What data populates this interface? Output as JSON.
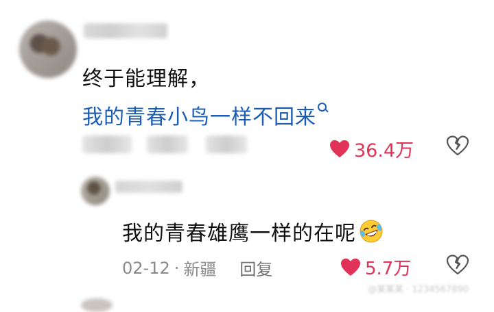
{
  "main_comment": {
    "line1": "终于能理解，",
    "line2": "我的青春小鸟一样不回来",
    "likes": "36.4万"
  },
  "reply": {
    "text": "我的青春雄鹰一样的在呢",
    "date": "02-12",
    "separator": "·",
    "location": "新疆",
    "reply_label": "回复",
    "likes": "5.7万"
  },
  "colors": {
    "link_blue": "#1b5cb5",
    "like_red": "#e03357",
    "meta_gray": "#8a8a8a"
  },
  "icons": [
    "search-icon",
    "heart-icon",
    "broken-heart-icon",
    "laughing-crying-emoji"
  ]
}
